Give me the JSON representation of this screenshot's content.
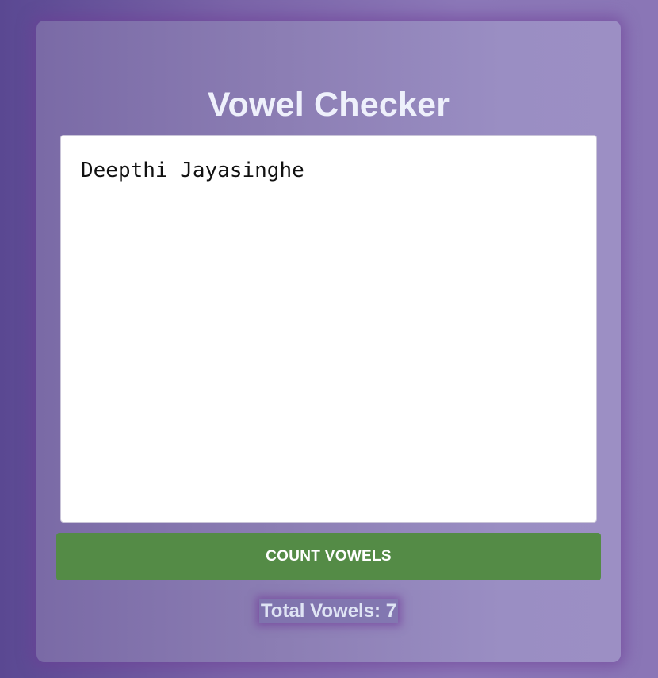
{
  "app": {
    "title": "Vowel Checker"
  },
  "input": {
    "value": "Deepthi Jayasinghe",
    "placeholder": ""
  },
  "actions": {
    "count_label": "COUNT VOWELS"
  },
  "result": {
    "text": "Total Vowels: 7",
    "count": 7
  },
  "colors": {
    "button": "#548b46",
    "title_text": "#eef0fb"
  }
}
